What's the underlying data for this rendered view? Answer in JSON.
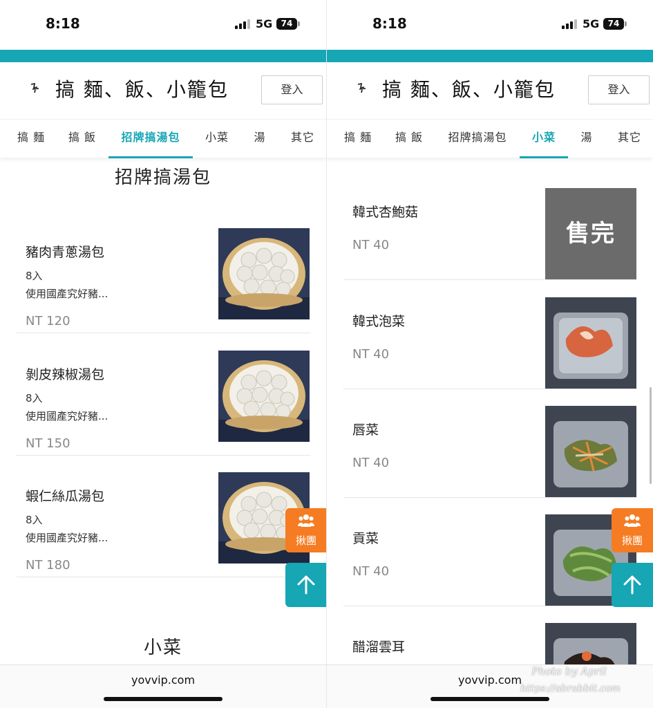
{
  "status": {
    "time": "8:18",
    "network": "5G",
    "battery": "74"
  },
  "header": {
    "title": "搞 麵、飯、小籠包",
    "login_label": "登入"
  },
  "tabs": [
    "搞 麵",
    "搞 飯",
    "招牌搞湯包",
    "小菜",
    "湯",
    "其它"
  ],
  "left": {
    "active_tab": "招牌搞湯包",
    "section_title": "招牌搞湯包",
    "next_section_title": "小菜",
    "items": [
      {
        "name": "豬肉青蔥湯包",
        "count": "8入",
        "desc": "使用國產究好豬...",
        "price": "NT 120",
        "image": "soup-dumplings-photo"
      },
      {
        "name": "剝皮辣椒湯包",
        "count": "8入",
        "desc": "使用國產究好豬...",
        "price": "NT 150",
        "image": "soup-dumplings-photo"
      },
      {
        "name": "蝦仁絲瓜湯包",
        "count": "8入",
        "desc": "使用國產究好豬...",
        "price": "NT 180",
        "image": "soup-dumplings-photo"
      }
    ]
  },
  "right": {
    "active_tab": "小菜",
    "sold_out_label": "售完",
    "items": [
      {
        "name": "韓式杏鮑菇",
        "price": "NT 40",
        "sold_out": true
      },
      {
        "name": "韓式泡菜",
        "price": "NT 40",
        "image": "kimchi-container-photo"
      },
      {
        "name": "唇菜",
        "price": "NT 40",
        "image": "salad-container-photo"
      },
      {
        "name": "貢菜",
        "price": "NT 40",
        "image": "green-vegetable-container-photo"
      },
      {
        "name": "醋溜雲耳",
        "price": "",
        "image": "wood-ear-container-photo"
      }
    ]
  },
  "fab": {
    "group_label": "揪團",
    "group_icon": "group-icon",
    "top_icon": "arrow-up-icon"
  },
  "url": "yovvip.com",
  "watermark": {
    "line1": "Photo by April",
    "line2": "https://abrabbit.com"
  },
  "colors": {
    "accent": "#16a6b4",
    "orange": "#f57c22",
    "sold_out_bg": "#6b6b6b"
  }
}
